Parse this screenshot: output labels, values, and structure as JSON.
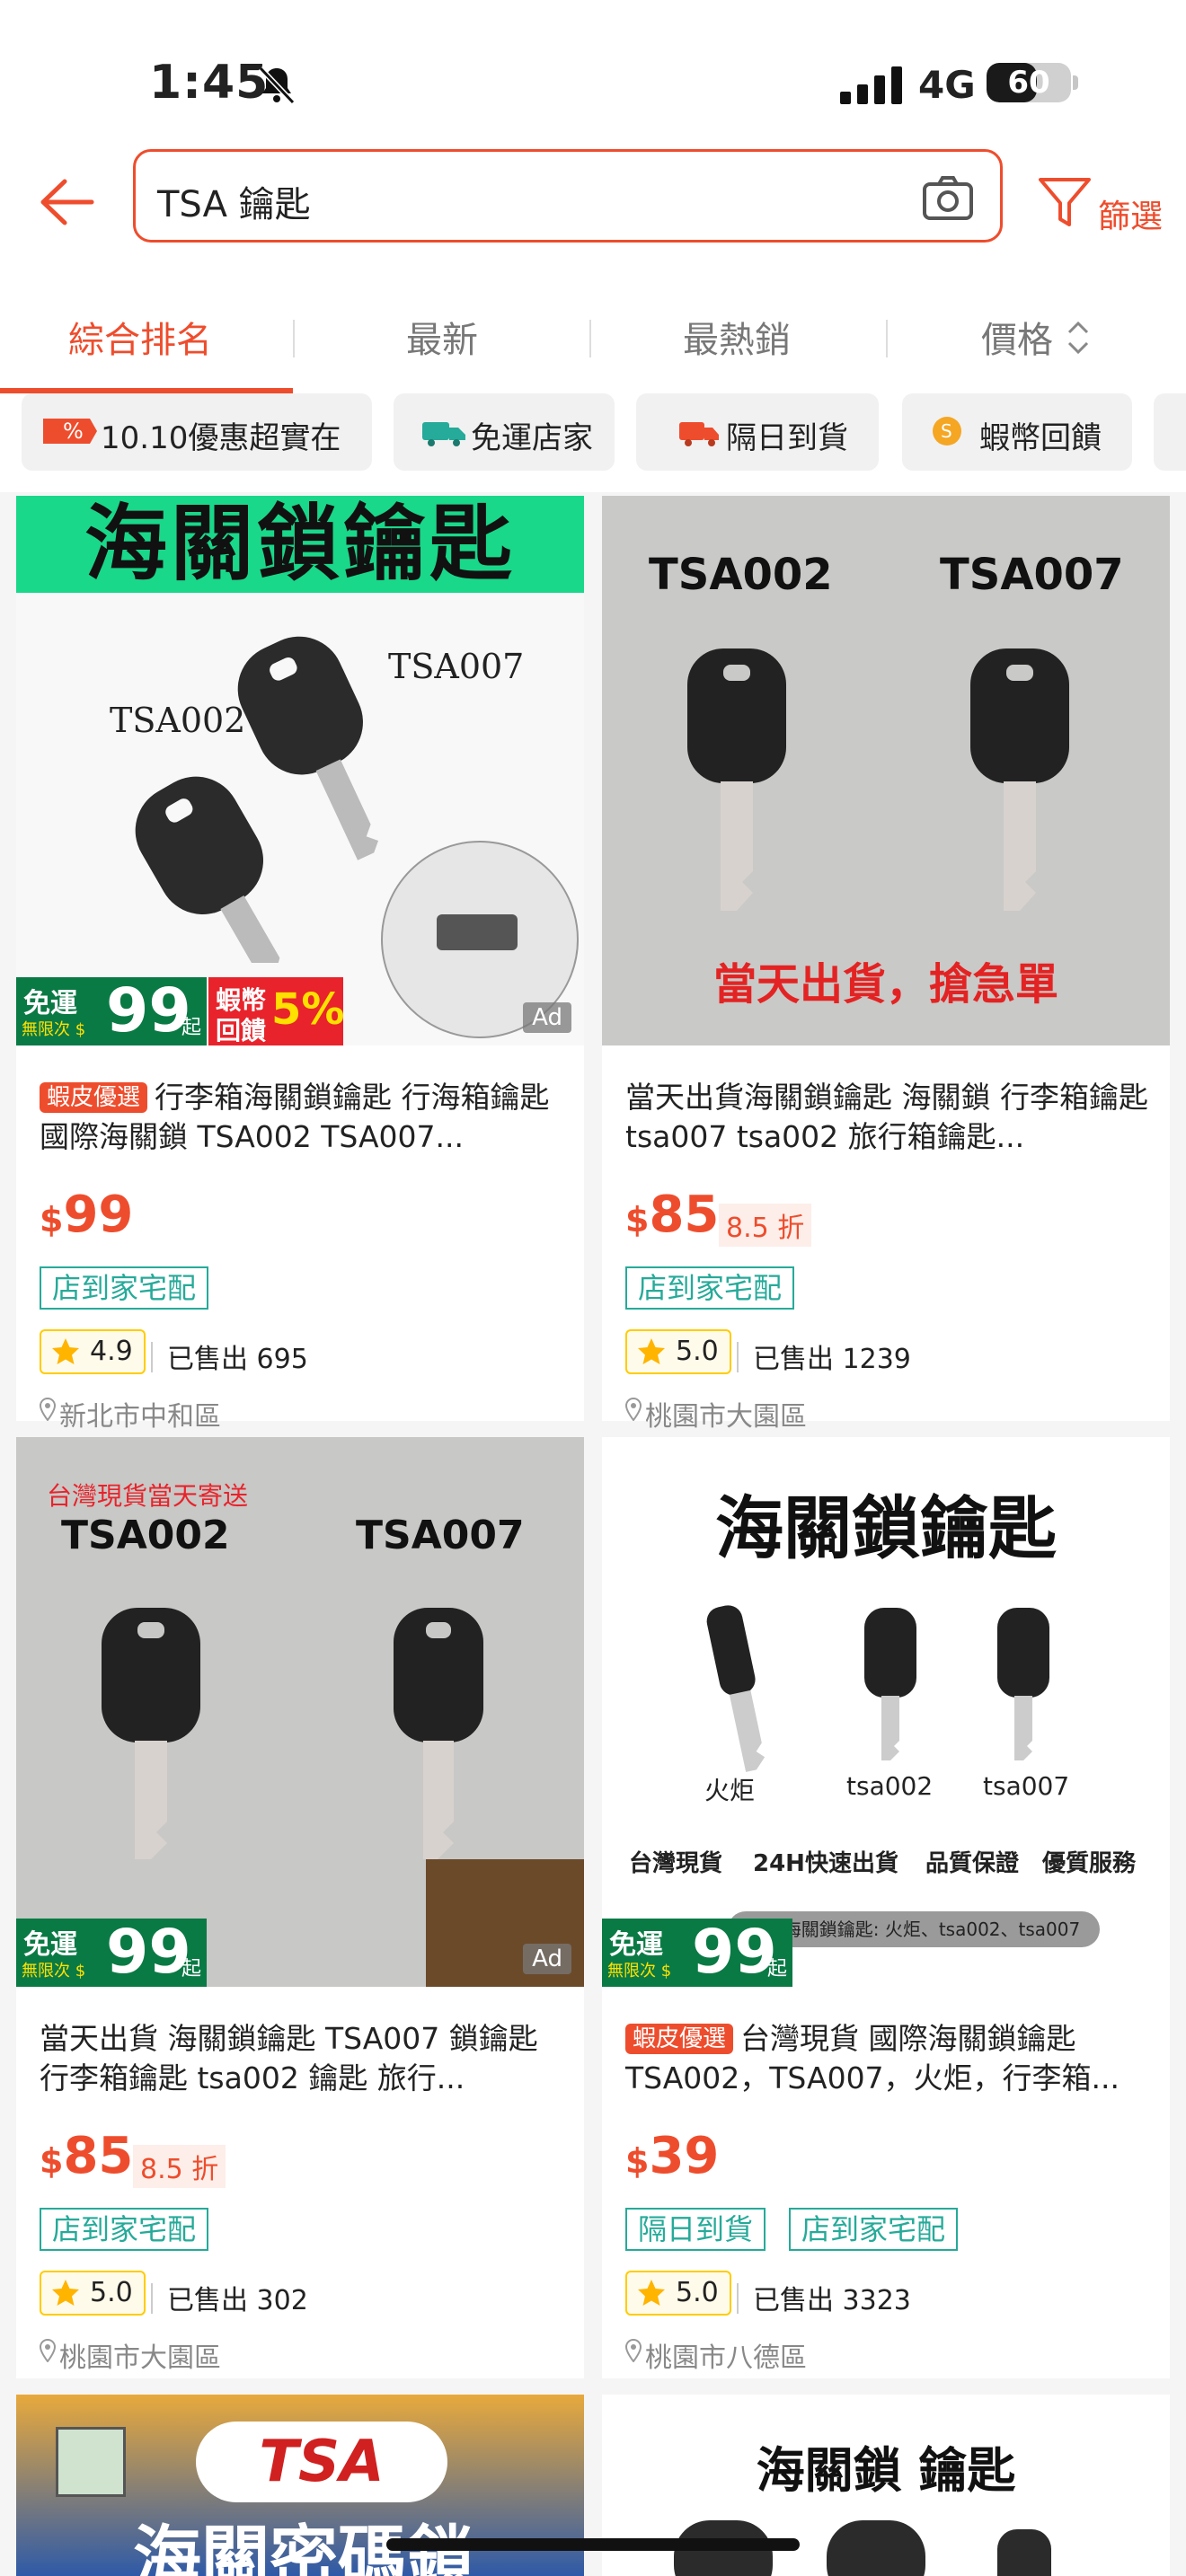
{
  "status": {
    "time": "1:45",
    "network": "4G",
    "battery": "60",
    "battery_level": 0.6
  },
  "search": {
    "query": "TSA 鑰匙",
    "filter_label": "篩選"
  },
  "sort_tabs": [
    "綜合排名",
    "最新",
    "最熱銷",
    "價格"
  ],
  "chips": [
    "10.10優惠超實在",
    "免運店家",
    "隔日到貨",
    "蝦幣回饋"
  ],
  "colors": {
    "accent": "#ee4d2d",
    "teal": "#26aa99",
    "free_ship_green": "#0a7a45"
  },
  "products": [
    {
      "image_headline": "海關鎖鑰匙",
      "image_labels": [
        "TSA002",
        "TSA007"
      ],
      "promo_tag": "蝦皮優選",
      "title": "行李箱海關鎖鑰匙 行海箱鑰匙 國際海關鎖 TSA002 TSA007...",
      "currency": "$",
      "price": "99",
      "discount": "",
      "delivery": [
        "店到家宅配"
      ],
      "rating": "4.9",
      "sold": "已售出 695",
      "location": "新北市中和區",
      "free_ship_badge": {
        "line1": "免運",
        "line2": "無限次 $",
        "amount": "99",
        "suffix": "起"
      },
      "coin_badge": {
        "line1": "蝦幣",
        "line2": "回饋",
        "pct": "5%"
      },
      "ad": "Ad"
    },
    {
      "image_labels": [
        "TSA002",
        "TSA007"
      ],
      "image_banner": "當天出貨，搶急單",
      "promo_tag": "",
      "title": "當天出貨海關鎖鑰匙 海關鎖 行李箱鑰匙 tsa007 tsa002 旅行箱鑰匙...",
      "currency": "$",
      "price": "85",
      "discount": "8.5 折",
      "delivery": [
        "店到家宅配"
      ],
      "rating": "5.0",
      "sold": "已售出 1239",
      "location": "桃園市大園區"
    },
    {
      "image_caption": "台灣現貨當天寄送",
      "image_labels": [
        "TSA002",
        "TSA007"
      ],
      "promo_tag": "",
      "title": "當天出貨 海關鎖鑰匙 TSA007 鎖鑰匙 行李箱鑰匙 tsa002 鑰匙 旅行...",
      "currency": "$",
      "price": "85",
      "discount": "8.5 折",
      "delivery": [
        "店到家宅配"
      ],
      "rating": "5.0",
      "sold": "已售出 302",
      "location": "桃園市大園區",
      "free_ship_badge": {
        "line1": "免運",
        "line2": "無限次 $",
        "amount": "99",
        "suffix": "起"
      },
      "ad": "Ad"
    },
    {
      "image_headline": "海關鎖鑰匙",
      "image_labels": [
        "火炬",
        "tsa002",
        "tsa007"
      ],
      "image_features": [
        "台灣現貨",
        "24H快速出貨",
        "品質保證",
        "優質服務"
      ],
      "image_note": "國際海關鎖鑰匙: 火炬、tsa002、tsa007",
      "promo_tag": "蝦皮優選",
      "title": "台灣現貨 國際海關鎖鑰匙 TSA002，TSA007，火炬，行李箱...",
      "currency": "$",
      "price": "39",
      "discount": "",
      "delivery": [
        "隔日到貨",
        "店到家宅配"
      ],
      "rating": "5.0",
      "sold": "已售出 3323",
      "location": "桃園市八德區",
      "free_ship_badge": {
        "line1": "免運",
        "line2": "無限次 $",
        "amount": "99",
        "suffix": "起"
      }
    },
    {
      "image_headline_a": "TSA",
      "image_headline_b": "海關密碼鎖"
    },
    {
      "image_headline": "海關鎖 鑰匙"
    }
  ]
}
